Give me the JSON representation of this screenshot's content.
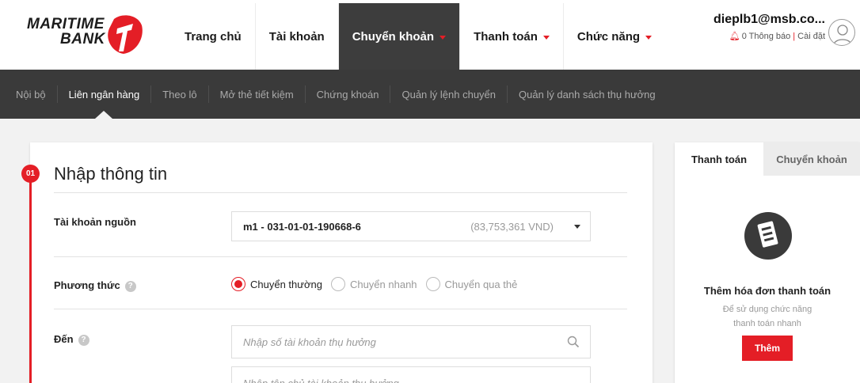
{
  "brand": {
    "line1": "MARITIME",
    "line2": "BANK",
    "accent": "#e41e26"
  },
  "mainnav": [
    {
      "label": "Trang chủ",
      "caret": false
    },
    {
      "label": "Tài khoản",
      "caret": false
    },
    {
      "label": "Chuyển khoản",
      "caret": true,
      "active": true
    },
    {
      "label": "Thanh toán",
      "caret": true
    },
    {
      "label": "Chức năng",
      "caret": true
    }
  ],
  "user": {
    "name": "dieplb1@msb.co...",
    "notifications": "0 Thông báo",
    "settings": "Cài đặt",
    "separator": "|"
  },
  "subnav": [
    {
      "label": "Nội bộ"
    },
    {
      "label": "Liên ngân hàng",
      "active": true
    },
    {
      "label": "Theo lô"
    },
    {
      "label": "Mở thẻ tiết kiệm"
    },
    {
      "label": "Chứng khoán"
    },
    {
      "label": "Quản lý lệnh chuyển"
    },
    {
      "label": "Quản lý danh sách thụ hưởng"
    }
  ],
  "form": {
    "step": "01",
    "title": "Nhập thông tin",
    "source_label": "Tài khoản nguồn",
    "source_account": "m1 - 031-01-01-190668-6",
    "source_balance": "(83,753,361 VND)",
    "method_label": "Phương thức",
    "help_glyph": "?",
    "methods": [
      {
        "label": "Chuyển thường",
        "checked": true
      },
      {
        "label": "Chuyển nhanh",
        "checked": false
      },
      {
        "label": "Chuyển qua thẻ",
        "checked": false
      }
    ],
    "to_label": "Đến",
    "account_placeholder": "Nhập số tài khoản thụ hưởng",
    "name_placeholder": "Nhập tên chủ tài khoản thụ hưởng"
  },
  "panel": {
    "tabs": [
      "Thanh toán",
      "Chuyển khoản"
    ],
    "title": "Thêm hóa đơn thanh toán",
    "desc_line1": "Để sử dụng chức năng",
    "desc_line2": "thanh toán nhanh",
    "button": "Thêm"
  }
}
